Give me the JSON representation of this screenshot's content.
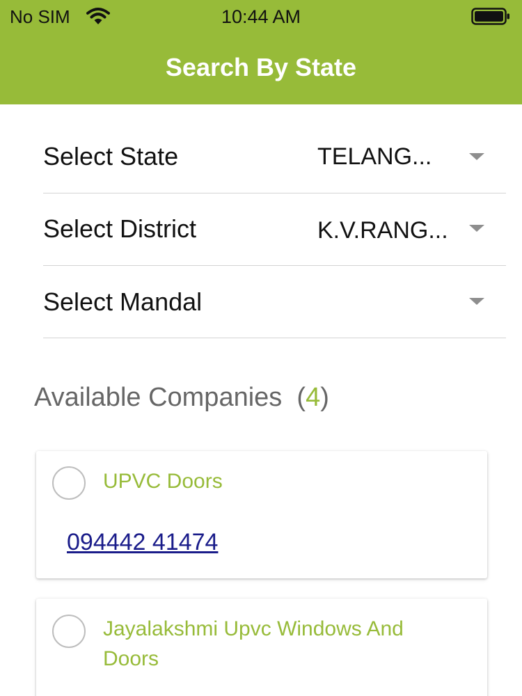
{
  "status_bar": {
    "carrier": "No SIM",
    "time": "10:44 AM",
    "icons": [
      "wifi-icon",
      "battery-icon"
    ]
  },
  "header": {
    "title": "Search By State"
  },
  "filters": {
    "state": {
      "label": "Select State",
      "value": "TELANG..."
    },
    "district": {
      "label": "Select District",
      "value": "K.V.RANG..."
    },
    "mandal": {
      "label": "Select Mandal",
      "value": ""
    }
  },
  "results": {
    "heading": "Available Companies",
    "count": "4",
    "open_paren": "(",
    "close_paren": ")"
  },
  "companies": [
    {
      "name": "UPVC Doors",
      "phone": "094442 41474"
    },
    {
      "name": "Jayalakshmi Upvc Windows And Doors",
      "phone": ""
    }
  ],
  "colors": {
    "accent": "#97bb39",
    "heading_gray": "#666666",
    "link": "#1a1c8a",
    "divider": "#d4d4d4"
  }
}
